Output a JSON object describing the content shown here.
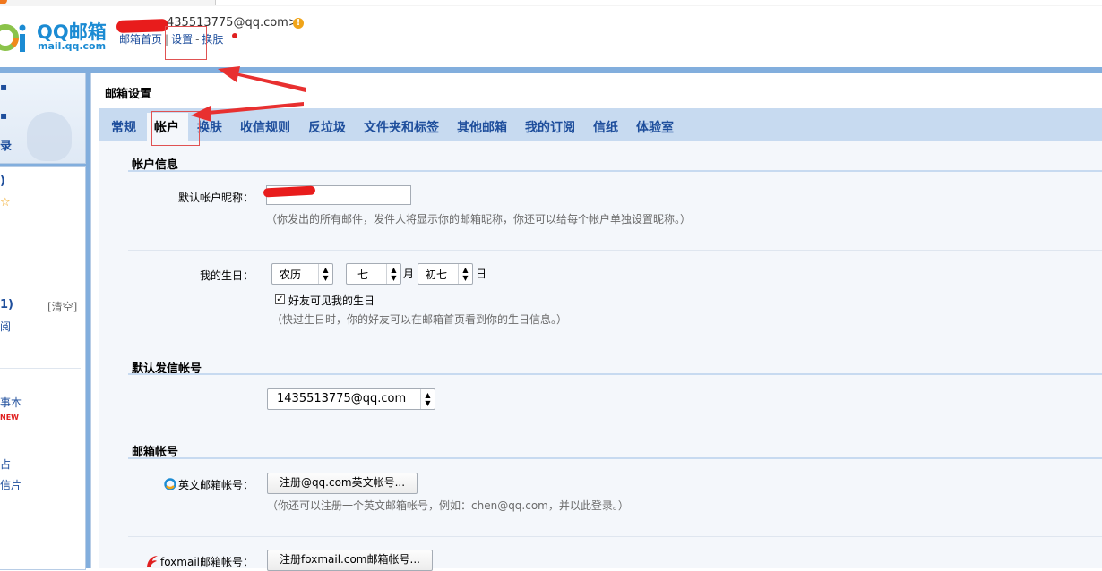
{
  "header": {
    "logo_title": "QQ邮箱",
    "logo_sub": "mail.qq.com",
    "user_email": "435513775@qq.com>",
    "warn_icon": "!",
    "nav": {
      "home": "邮箱首页",
      "sep": "|",
      "settings": "设置",
      "dash": "-",
      "skin": "换肤"
    }
  },
  "sidebar": {
    "t1": "录",
    "t2": ")",
    "t3": "☆",
    "t4": "1)",
    "t5": "[清空]",
    "t6": "阅",
    "t7": "事本",
    "t8": "NEW",
    "t9": "占",
    "t10": "信片"
  },
  "main": {
    "title": "邮箱设置",
    "tabs": [
      "常规",
      "帐户",
      "换肤",
      "收信规则",
      "反垃圾",
      "文件夹和标签",
      "其他邮箱",
      "我的订阅",
      "信纸",
      "体验室"
    ],
    "account_info": {
      "heading": "帐户信息",
      "nickname_label": "默认帐户昵称：",
      "nickname_hint": "（你发出的所有邮件，发件人将显示你的邮箱昵称，你还可以给每个帐户单独设置昵称。）"
    },
    "birthday": {
      "label": "我的生日：",
      "calendar": "农历",
      "month": "七",
      "month_unit": "月",
      "day": "初七",
      "day_unit": "日",
      "friends_visible": "好友可见我的生日",
      "hint": "（快过生日时，你的好友可以在邮箱首页看到你的生日信息。）"
    },
    "default_sender": {
      "heading": "默认发信帐号",
      "value": "1435513775@qq.com"
    },
    "mail_accounts": {
      "heading": "邮箱帐号",
      "english_label": "英文邮箱帐号：",
      "english_button": "注册@qq.com英文帐号...",
      "english_hint": "（你还可以注册一个英文邮箱帐号，例如：chen@qq.com，并以此登录。）",
      "foxmail_label": "foxmail邮箱帐号：",
      "foxmail_button": "注册foxmail.com邮箱帐号..."
    }
  },
  "colors": {
    "accent": "#1e4e9c",
    "tab_bar": "#c7daf0",
    "annotation_red": "#e83030"
  }
}
